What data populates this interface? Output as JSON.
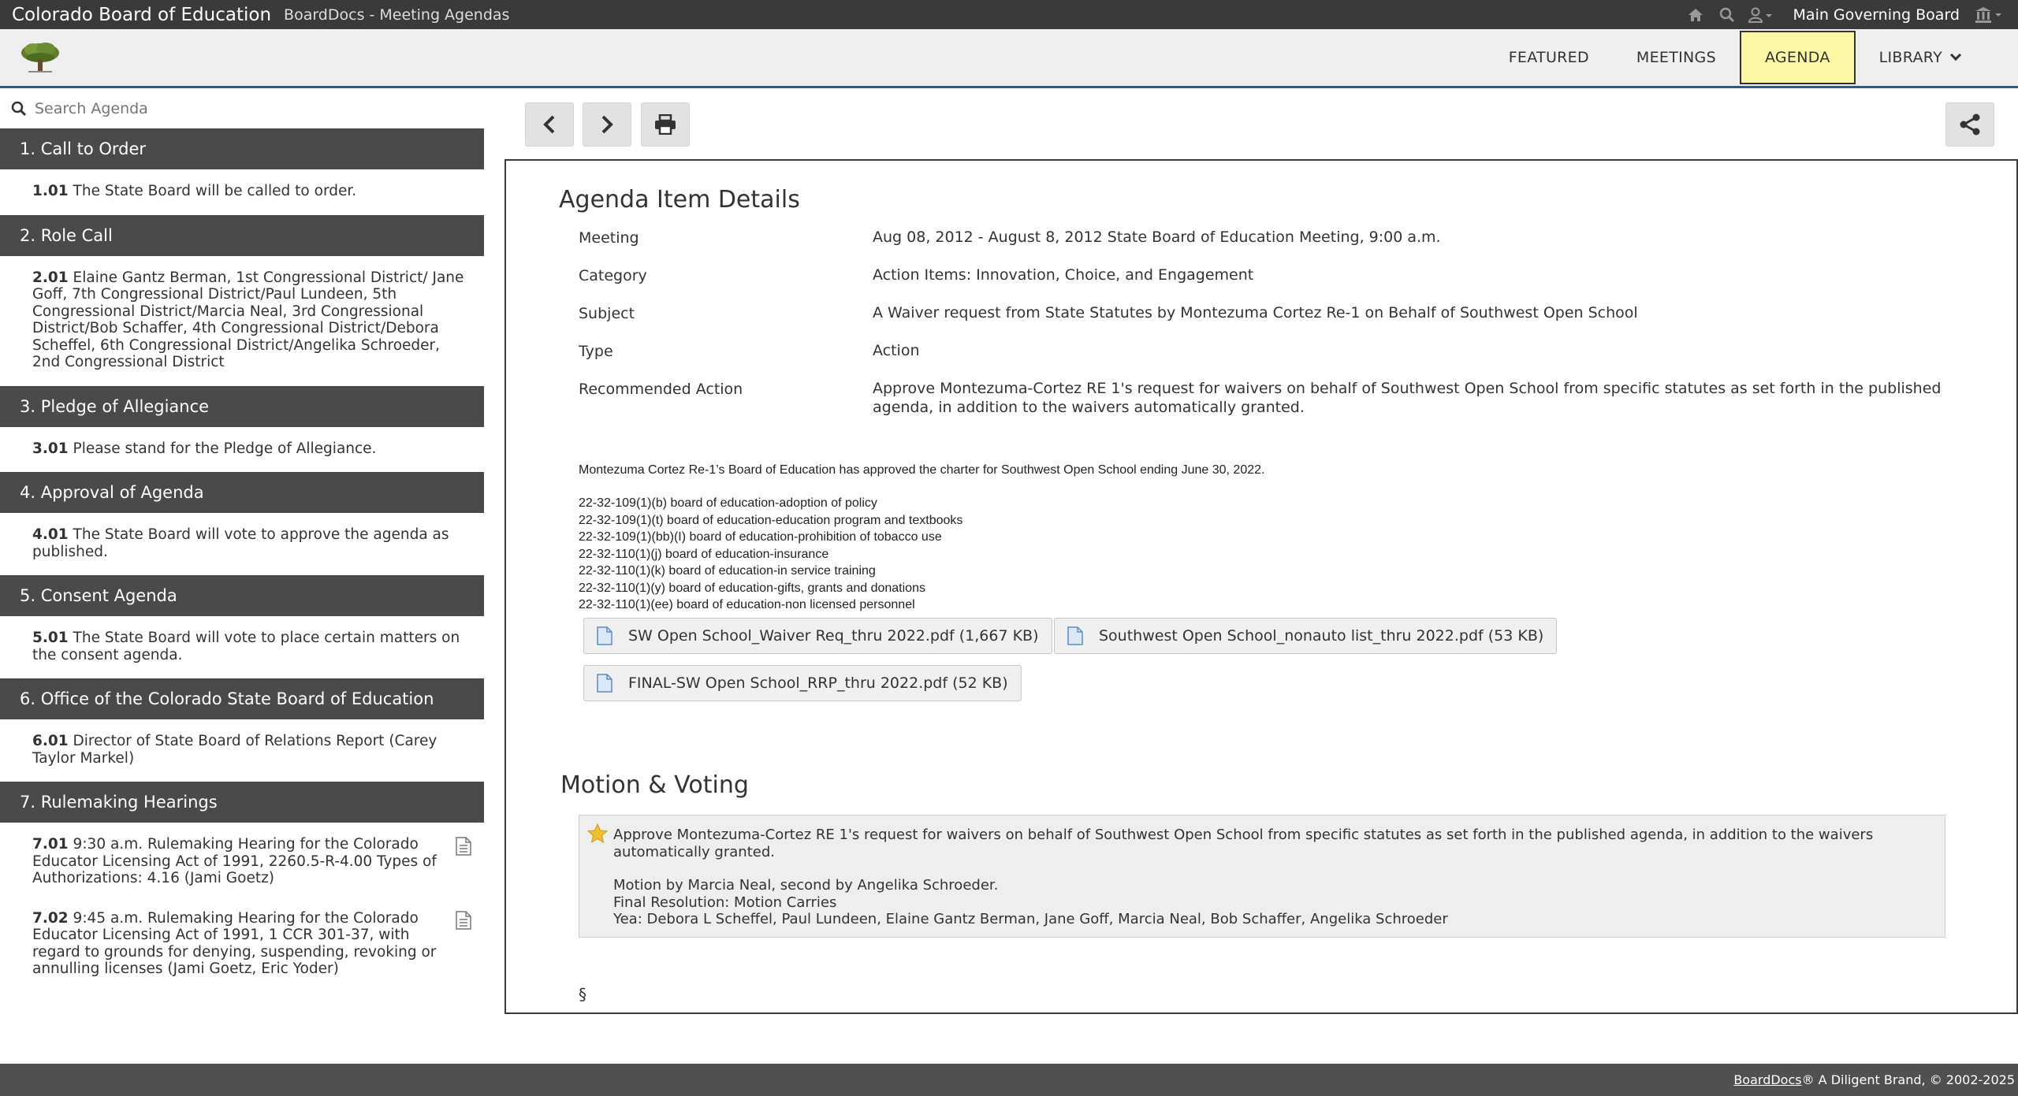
{
  "topbar": {
    "org": "Colorado Board of Education",
    "app": "BoardDocs - Meeting Agendas",
    "board": "Main Governing Board"
  },
  "nav": {
    "featured": "FEATURED",
    "meetings": "MEETINGS",
    "agenda": "AGENDA",
    "library": "LIBRARY"
  },
  "search": {
    "placeholder": "Search Agenda"
  },
  "agenda": [
    {
      "title": "1. Call to Order",
      "items": [
        {
          "num": "1.01",
          "text": "The State Board will be called to order."
        }
      ]
    },
    {
      "title": "2. Role Call",
      "items": [
        {
          "num": "2.01",
          "text": "Elaine Gantz Berman, 1st Congressional District/ Jane Goff, 7th Congressional District/Paul Lundeen, 5th Congressional District/Marcia Neal, 3rd Congressional District/Bob Schaffer, 4th Congressional District/Debora Scheffel, 6th Congressional District/Angelika Schroeder, 2nd Congressional District"
        }
      ]
    },
    {
      "title": "3. Pledge of Allegiance",
      "items": [
        {
          "num": "3.01",
          "text": "Please stand for the Pledge of Allegiance."
        }
      ]
    },
    {
      "title": "4. Approval of Agenda",
      "items": [
        {
          "num": "4.01",
          "text": "The State Board will vote to approve the agenda as published."
        }
      ]
    },
    {
      "title": "5. Consent Agenda",
      "items": [
        {
          "num": "5.01",
          "text": "The State Board will vote to place certain matters on the consent agenda."
        }
      ]
    },
    {
      "title": "6. Office of the Colorado State Board of Education",
      "items": [
        {
          "num": "6.01",
          "text": "Director of State Board of Relations Report (Carey Taylor Markel)"
        }
      ]
    },
    {
      "title": "7. Rulemaking Hearings",
      "items": [
        {
          "num": "7.01",
          "text": "9:30 a.m. Rulemaking Hearing for the Colorado Educator Licensing Act of 1991, 2260.5-R-4.00 Types of Authorizations: 4.16 (Jami Goetz)"
        },
        {
          "num": "7.02",
          "text": "9:45 a.m. Rulemaking Hearing for the Colorado Educator Licensing Act of 1991, 1 CCR 301-37, with regard to grounds for denying, suspending, revoking or annulling licenses (Jami Goetz, Eric Yoder)"
        }
      ]
    }
  ],
  "details": {
    "heading": "Agenda Item Details",
    "meeting_label": "Meeting",
    "meeting": "Aug 08, 2012 - August 8, 2012 State Board of Education Meeting, 9:00 a.m.",
    "category_label": "Category",
    "category": "Action Items: Innovation, Choice, and Engagement",
    "subject_label": "Subject",
    "subject": "A Waiver request from State Statutes by Montezuma Cortez Re-1 on Behalf of Southwest Open School",
    "type_label": "Type",
    "type": "Action",
    "recommended_label": "Recommended Action",
    "recommended": "Approve Montezuma-Cortez RE 1's request for waivers on behalf of Southwest Open School from specific statutes as set forth in the published agenda, in addition to the waivers automatically granted.",
    "charter_note": "Montezuma Cortez Re-1’s Board of Education has approved the charter for Southwest Open School ending June 30, 2022.",
    "statutes": [
      "22-32-109(1)(b) board of education-adoption of policy",
      "22-32-109(1)(t) board of education-education program and textbooks",
      "22-32-109(1)(bb)(I) board of education-prohibition of tobacco use",
      "22-32-110(1)(j) board of education-insurance",
      "22-32-110(1)(k) board of education-in service training",
      "22-32-110(1)(y) board of education-gifts, grants and donations",
      "22-32-110(1)(ee) board of education-non licensed personnel"
    ],
    "attachments": [
      "SW Open School_Waiver Req_thru 2022.pdf (1,667 KB)",
      "Southwest Open School_nonauto list_thru 2022.pdf (53 KB)",
      "FINAL-SW Open School_RRP_thru 2022.pdf (52 KB)"
    ]
  },
  "motion": {
    "heading": "Motion & Voting",
    "text": "Approve Montezuma-Cortez RE 1's request for waivers on behalf of Southwest Open School from specific statutes as set forth in the published agenda, in addition to the waivers automatically granted.",
    "by": "Motion by Marcia Neal, second by Angelika Schroeder.",
    "resolution": "Final Resolution: Motion Carries",
    "yea": "Yea: Debora L Scheffel, Paul Lundeen, Elaine Gantz Berman, Jane Goff, Marcia Neal, Bob Schaffer, Angelika Schroeder"
  },
  "section_mark": "§",
  "footer": {
    "brand": "BoardDocs",
    "rest": "® A Diligent Brand, © 2002-2025"
  }
}
